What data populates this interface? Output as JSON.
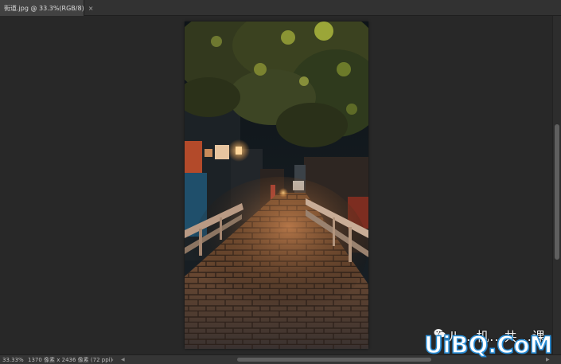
{
  "tab": {
    "title": "街道.jpg @ 33.3%(RGB/8)",
    "close_glyph": "×"
  },
  "status": {
    "zoom": "33.33%",
    "doc_info": "1370 像素 x 2436 像素 (72 ppi)",
    "more_glyph": "›",
    "left_arrow": "◀",
    "right_arrow": "▶"
  },
  "watermark": {
    "small_text": "ル...机...共...课",
    "big_text": "UiBQ.CoM",
    "icon": "wechat-icon"
  },
  "colors": {
    "workspace": "#282828",
    "panel": "#323232",
    "watermark_outline": "#2a8ed6"
  }
}
